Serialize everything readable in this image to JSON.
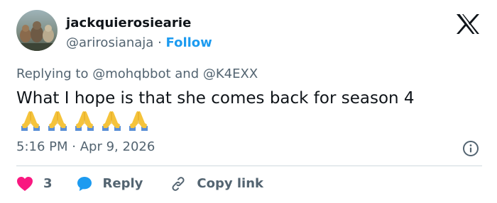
{
  "author": {
    "display_name": "jackquierosiearie",
    "handle": "@arirosianaja",
    "separator": "·",
    "follow_label": "Follow"
  },
  "reply_context": {
    "prefix": "Replying to",
    "mentions": [
      "@mohqbbot",
      "@K4EXX"
    ],
    "joiner": "and"
  },
  "tweet": {
    "text": "What I hope is that she comes back for season 4",
    "emojis": [
      "folded-hands",
      "folded-hands",
      "folded-hands",
      "folded-hands",
      "folded-hands"
    ]
  },
  "meta": {
    "time": "5:16 PM",
    "separator": "·",
    "date": "Apr 9, 2026"
  },
  "actions": {
    "like_count": "3",
    "reply_label": "Reply",
    "copy_link_label": "Copy link"
  },
  "colors": {
    "accent": "#1d9bf0",
    "like": "#f91880",
    "muted": "#536471",
    "text": "#0f1419"
  },
  "icons": {
    "logo": "x-logo",
    "info": "info-icon",
    "like": "heart-icon",
    "reply": "speech-bubble-icon",
    "copy": "link-icon"
  }
}
